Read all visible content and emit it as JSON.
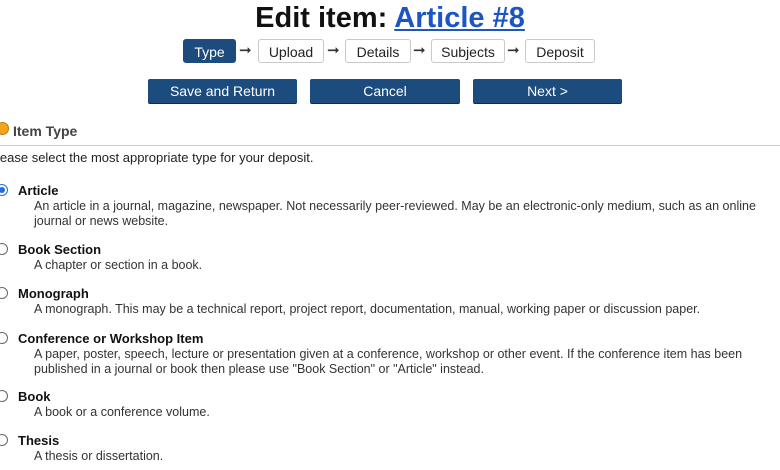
{
  "page": {
    "title_prefix": "Edit item:",
    "title_link": "Article #8"
  },
  "steps": [
    {
      "label": "Type",
      "active": true
    },
    {
      "label": "Upload",
      "active": false
    },
    {
      "label": "Details",
      "active": false
    },
    {
      "label": "Subjects",
      "active": false
    },
    {
      "label": "Deposit",
      "active": false
    }
  ],
  "buttons": {
    "save": "Save and Return",
    "cancel": "Cancel",
    "next": "Next >"
  },
  "section": {
    "title": "Item Type",
    "instructions": "lease select the most appropriate type for your deposit."
  },
  "item_types": [
    {
      "label": "Article",
      "selected": true,
      "description": "An article in a journal, magazine, newspaper. Not necessarily peer-reviewed. May be an electronic-only medium, such as an online journal or news website."
    },
    {
      "label": "Book Section",
      "selected": false,
      "description": "A chapter or section in a book."
    },
    {
      "label": "Monograph",
      "selected": false,
      "description": "A monograph. This may be a technical report, project report, documentation, manual, working paper or discussion paper."
    },
    {
      "label": "Conference or Workshop Item",
      "selected": false,
      "description": "A paper, poster, speech, lecture or presentation given at a conference, workshop or other event. If the conference item has been published in a journal or book then please use \"Book Section\" or \"Article\" instead."
    },
    {
      "label": "Book",
      "selected": false,
      "description": "A book or a conference volume."
    },
    {
      "label": "Thesis",
      "selected": false,
      "description": "A thesis or dissertation."
    }
  ],
  "colors": {
    "accent": "#1c4b7d",
    "link": "#1d55c4",
    "section_icon": "#f2a51b"
  }
}
